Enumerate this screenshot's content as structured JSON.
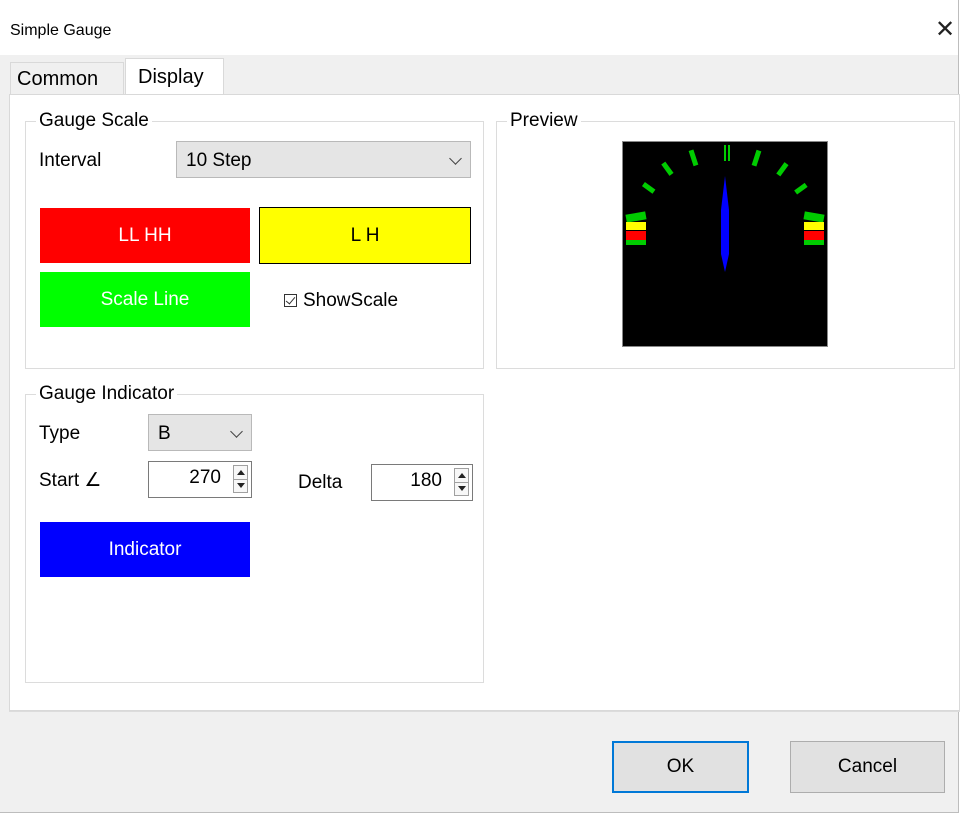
{
  "window": {
    "title": "Simple Gauge",
    "close_glyph": "✕"
  },
  "tabs": [
    {
      "label": "Common",
      "active": false
    },
    {
      "label": "Display",
      "active": true
    }
  ],
  "gauge_scale": {
    "group_label": "Gauge Scale",
    "interval_label": "Interval",
    "interval_value": "10 Step",
    "ll_hh_label": "LL HH",
    "ll_hh_color": "#ff0000",
    "l_h_label": "L H",
    "l_h_color": "#ffff00",
    "scale_line_label": "Scale Line",
    "scale_line_color": "#00ff00",
    "show_scale_label": "ShowScale",
    "show_scale_checked": true
  },
  "preview": {
    "group_label": "Preview",
    "background": "#000000",
    "scale_color": "#00cc00",
    "needle_color": "#0000ff"
  },
  "gauge_indicator": {
    "group_label": "Gauge Indicator",
    "type_label": "Type",
    "type_value": "B",
    "start_label": "Start ∠",
    "start_value": "270",
    "delta_label": "Delta",
    "delta_value": "180",
    "indicator_label": "Indicator",
    "indicator_color": "#0000ff"
  },
  "buttons": {
    "ok": "OK",
    "cancel": "Cancel"
  }
}
